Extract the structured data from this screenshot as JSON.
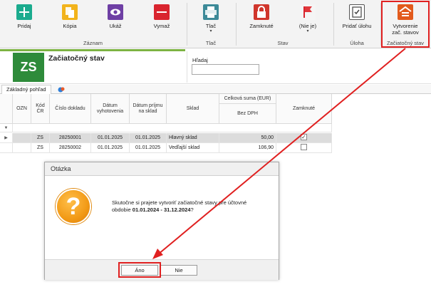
{
  "ribbon": {
    "groups": {
      "zaznam": "Záznam",
      "tlac": "Tlač",
      "stav": "Stav",
      "uloha": "Úloha",
      "zaciatocny": "Začiatočný stav"
    },
    "buttons": {
      "pridaj": "Pridaj",
      "kopia": "Kópia",
      "ukaz": "Ukáž",
      "vymaz": "Vymaž",
      "tlac": "Tlač",
      "zamknute": "Zamknuté",
      "nie_je": "(Nie je)",
      "pridat_ulohu": "Pridať úlohu",
      "vytvorenie_line1": "Vytvorenie",
      "vytvorenie_line2": "zač. stavov"
    }
  },
  "header": {
    "tile": "ZS",
    "title": "Začiatočný stav",
    "search_label": "Hľadaj",
    "search_value": ""
  },
  "tab": {
    "label": "Základný pohľad"
  },
  "grid": {
    "headers": {
      "ozn": "OZN",
      "kod_cr_line1": "Kód",
      "kod_cr_line2": "ČR",
      "cislo": "Číslo dokladu",
      "datum_vyh_line1": "Dátum",
      "datum_vyh_line2": "vyhotovenia",
      "datum_prij_line1": "Dátum príjmu",
      "datum_prij_line2": "na sklad",
      "sklad": "Sklad",
      "celkova": "Celková suma (EUR)",
      "bez_dph": "Bez DPH",
      "zamknute": "Zamknuté"
    },
    "rows": [
      {
        "ozn": "",
        "kod": "ZS",
        "cislo": "28250001",
        "datum_vyh": "01.01.2025",
        "datum_prij": "01.01.2025",
        "sklad": "Hlavný sklad",
        "bez_dph": "50,00",
        "zamknute": true
      },
      {
        "ozn": "",
        "kod": "ZS",
        "cislo": "28250002",
        "datum_vyh": "01.01.2025",
        "datum_prij": "01.01.2025",
        "sklad": "Vedľajší sklad",
        "bez_dph": "106,90",
        "zamknute": false
      }
    ]
  },
  "dialog": {
    "title": "Otázka",
    "message_line1": "Skutočne si prajete vytvoriť začiatočné stavy pre účtovné",
    "message_line2_prefix": "obdobie ",
    "message_period": "01.01.2024 - 31.12.2024",
    "message_suffix": "?",
    "yes_button": "Áno",
    "no_button": "Nie",
    "icon": "question-icon"
  },
  "colors": {
    "annotation_red": "#e02020",
    "tile_green": "#2e8b3a",
    "question_orange": "#f29a16"
  }
}
